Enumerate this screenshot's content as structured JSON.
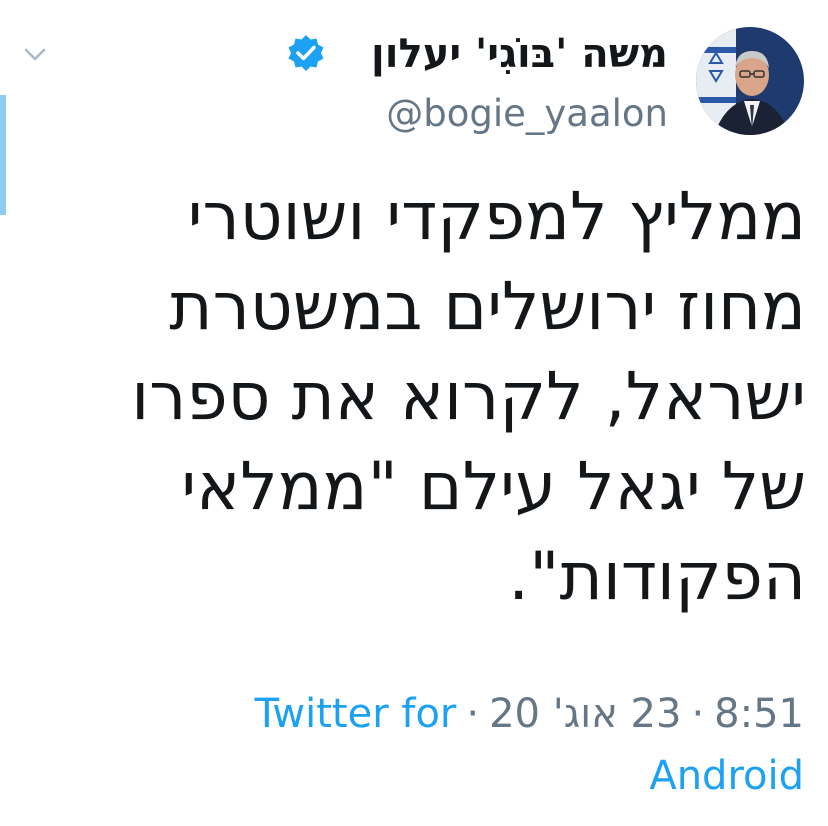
{
  "author": {
    "display_name": "משה 'בּוֹגִי' יעלון",
    "handle": "@bogie_yaalon",
    "verified": true
  },
  "tweet": {
    "lines": [
      "ממליץ למפקדי ושוטרי",
      "מחוז ירושלים במשטרת",
      "ישראל, לקרוא את ספרו",
      "של יגאל עילם \"ממלאי",
      "הפקודות\"."
    ]
  },
  "meta": {
    "time": "8:51",
    "separator": "·",
    "date": "23 אוג' 20",
    "source_part1": "Twitter for",
    "source_part2": "Android"
  },
  "colors": {
    "text": "#14171a",
    "secondary": "#657786",
    "link": "#1da1f2",
    "verified": "#1da1f2",
    "accent_bar": "#8ecdf0"
  },
  "icons": {
    "verified": "verified-badge-icon",
    "chevron": "chevron-down-icon"
  }
}
